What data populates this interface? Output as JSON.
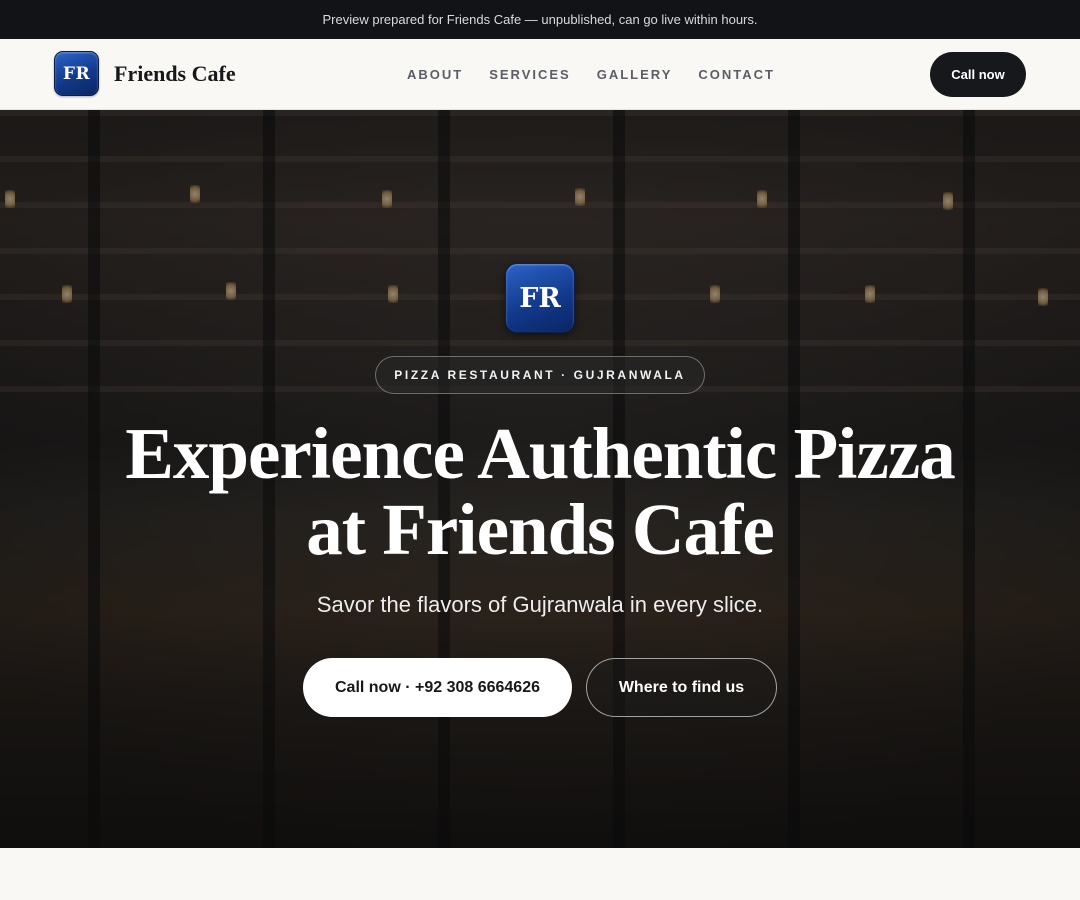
{
  "announcement": "Preview prepared for Friends Cafe — unpublished, can go live within hours.",
  "header": {
    "logo_text": "FR",
    "brand_name": "Friends Cafe",
    "nav": [
      {
        "label": "ABOUT"
      },
      {
        "label": "SERVICES"
      },
      {
        "label": "GALLERY"
      },
      {
        "label": "CONTACT"
      }
    ],
    "call_label": "Call now"
  },
  "hero": {
    "logo_text": "FR",
    "badge": "PIZZA RESTAURANT · GUJRANWALA",
    "headline_line1": "Experience Authentic Pizza",
    "headline_line2": "at Friends Cafe",
    "subtitle": "Savor the flavors of Gujranwala in every slice.",
    "primary_button": "Call now · +92 308 6664626",
    "secondary_button": "Where to find us",
    "background_image": "restaurant-interior-photo"
  },
  "colors": {
    "announcement_bg": "#111317",
    "logo_blue": "#123a8c",
    "dark_button": "#17181c",
    "page_bg": "#f9f8f5"
  }
}
